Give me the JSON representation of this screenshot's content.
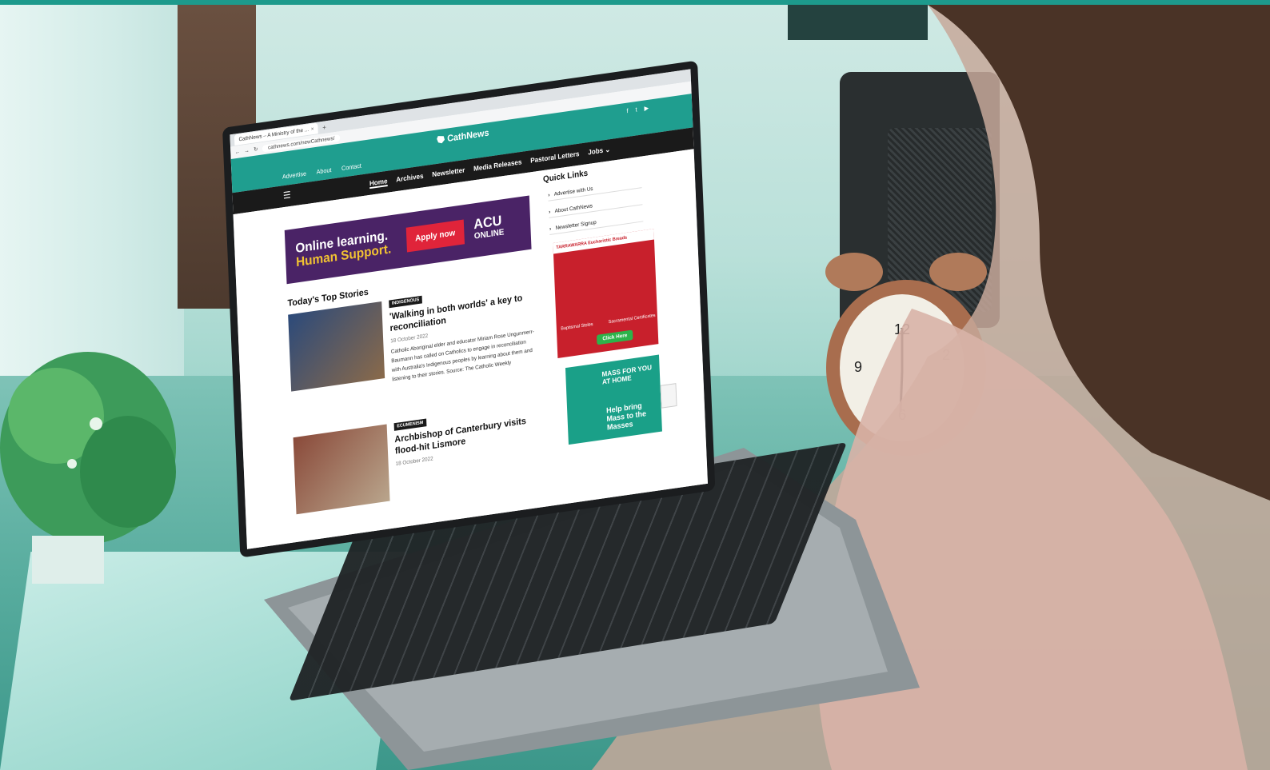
{
  "colors": {
    "brand_teal": "#1f9e8f",
    "nav_black": "#1a1a1a",
    "banner_purple": "#4a2366",
    "apply_red": "#e0243a"
  },
  "browser": {
    "tab_title": "CathNews – A Ministry of the ...",
    "tab_close": "×",
    "new_tab": "+",
    "address": "cathnews.com/newCathnews/",
    "nav_icons": [
      "back-icon",
      "forward-icon",
      "reload-icon"
    ]
  },
  "site": {
    "logo": "CathNews",
    "social_icons": [
      "facebook-icon",
      "twitter-icon",
      "youtube-icon"
    ],
    "top_links": [
      "Advertise",
      "About",
      "Contact"
    ],
    "main_nav": [
      "Home",
      "Archives",
      "Newsletter",
      "Media Releases",
      "Pastoral Letters",
      "Jobs ⌄"
    ],
    "active_nav": "Home",
    "menu_icon": "☰"
  },
  "banner": {
    "line1": "Online learning.",
    "line2": "Human Support.",
    "cta": "Apply now",
    "brand": "ACU",
    "brand_sub": "ONLINE"
  },
  "stories": {
    "section_title": "Today's Top Stories",
    "items": [
      {
        "tag": "INDIGENOUS",
        "headline": "'Walking in both worlds' a key to reconciliation",
        "date": "18 October 2022",
        "summary": "Catholic Aboriginal elder and educator Miriam Rose Ungunmerr-Baumann has called on Catholics to engage in reconciliation with Australia's Indigenous peoples by learning about them and listening to their stories. Source: The Catholic Weekly"
      },
      {
        "tag": "ECUMENISM",
        "headline": "Archbishop of Canterbury visits flood-hit Lismore",
        "date": "18 October 2022",
        "summary": ""
      }
    ]
  },
  "sidebar": {
    "title": "Quick Links",
    "links": [
      "Advertise with Us",
      "About CathNews",
      "Newsletter Signup"
    ],
    "ad_red": {
      "header": "TARRAWARRA Eucharistic Breads",
      "label_left": "Baptismal Stoles",
      "label_right": "Sacramental Certificates",
      "cta": "Click Here"
    },
    "ad_mass": {
      "title": "MASS FOR YOU AT HOME",
      "tagline": "Help bring Mass to the Masses"
    }
  }
}
